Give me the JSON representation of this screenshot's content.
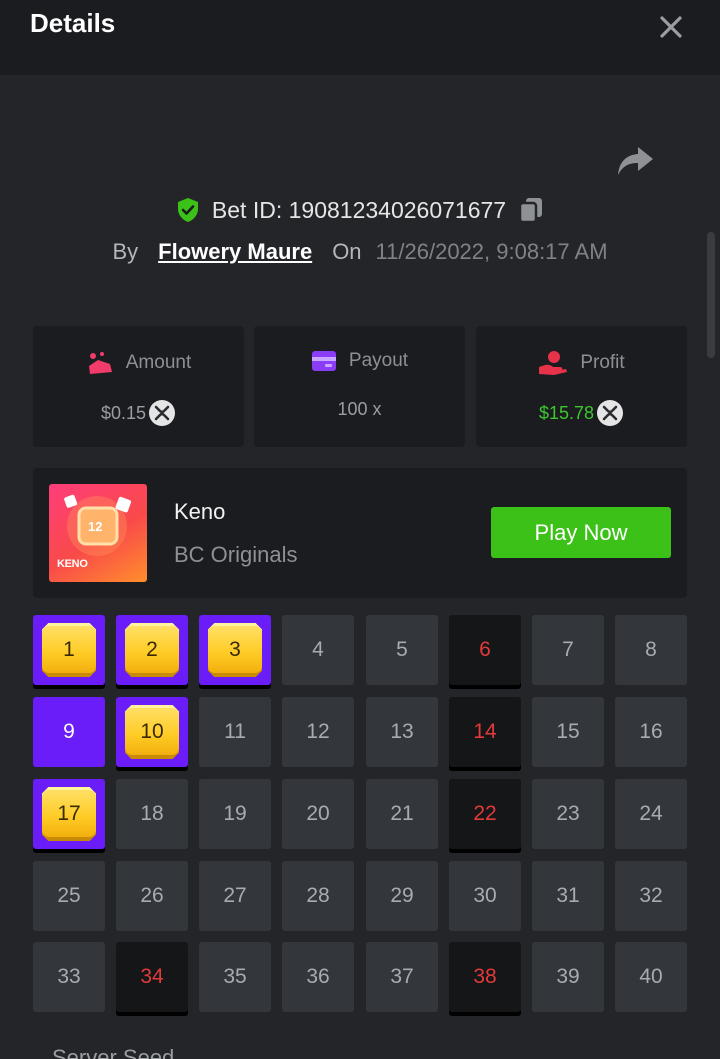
{
  "header": {
    "title": "Details"
  },
  "bet": {
    "id_text": "Bet ID: 19081234026071677"
  },
  "by_line": {
    "by_label": "By",
    "username": "Flowery Maure",
    "on_label": "On",
    "datetime": "11/26/2022, 9:08:17 AM"
  },
  "stats": {
    "amount": {
      "label": "Amount",
      "value": "$0.15"
    },
    "payout": {
      "label": "Payout",
      "value": "100 x"
    },
    "profit": {
      "label": "Profit",
      "value": "$15.78"
    }
  },
  "game": {
    "name": "Keno",
    "provider": "BC Originals",
    "play_label": "Play Now",
    "thumb_label": "KENO",
    "thumb_number": "12"
  },
  "keno_tiles": [
    {
      "n": "1",
      "s": "gem"
    },
    {
      "n": "2",
      "s": "gem"
    },
    {
      "n": "3",
      "s": "gem"
    },
    {
      "n": "4",
      "s": "normal"
    },
    {
      "n": "5",
      "s": "normal"
    },
    {
      "n": "6",
      "s": "miss"
    },
    {
      "n": "7",
      "s": "normal"
    },
    {
      "n": "8",
      "s": "normal"
    },
    {
      "n": "9",
      "s": "hit"
    },
    {
      "n": "10",
      "s": "gem"
    },
    {
      "n": "11",
      "s": "normal"
    },
    {
      "n": "12",
      "s": "normal"
    },
    {
      "n": "13",
      "s": "normal"
    },
    {
      "n": "14",
      "s": "miss"
    },
    {
      "n": "15",
      "s": "normal"
    },
    {
      "n": "16",
      "s": "normal"
    },
    {
      "n": "17",
      "s": "gem"
    },
    {
      "n": "18",
      "s": "normal"
    },
    {
      "n": "19",
      "s": "normal"
    },
    {
      "n": "20",
      "s": "normal"
    },
    {
      "n": "21",
      "s": "normal"
    },
    {
      "n": "22",
      "s": "miss"
    },
    {
      "n": "23",
      "s": "normal"
    },
    {
      "n": "24",
      "s": "normal"
    },
    {
      "n": "25",
      "s": "normal"
    },
    {
      "n": "26",
      "s": "normal"
    },
    {
      "n": "27",
      "s": "normal"
    },
    {
      "n": "28",
      "s": "normal"
    },
    {
      "n": "29",
      "s": "normal"
    },
    {
      "n": "30",
      "s": "normal"
    },
    {
      "n": "31",
      "s": "normal"
    },
    {
      "n": "32",
      "s": "normal"
    },
    {
      "n": "33",
      "s": "normal"
    },
    {
      "n": "34",
      "s": "miss"
    },
    {
      "n": "35",
      "s": "normal"
    },
    {
      "n": "36",
      "s": "normal"
    },
    {
      "n": "37",
      "s": "normal"
    },
    {
      "n": "38",
      "s": "miss"
    },
    {
      "n": "39",
      "s": "normal"
    },
    {
      "n": "40",
      "s": "normal"
    }
  ],
  "footer": {
    "seed_label": "Server Seed"
  },
  "colors": {
    "accent_purple": "#6a1df8",
    "play_green": "#3bc117",
    "profit_green": "#3cc72e",
    "miss_red": "#e23a3a",
    "shield_green": "#3bc117"
  }
}
